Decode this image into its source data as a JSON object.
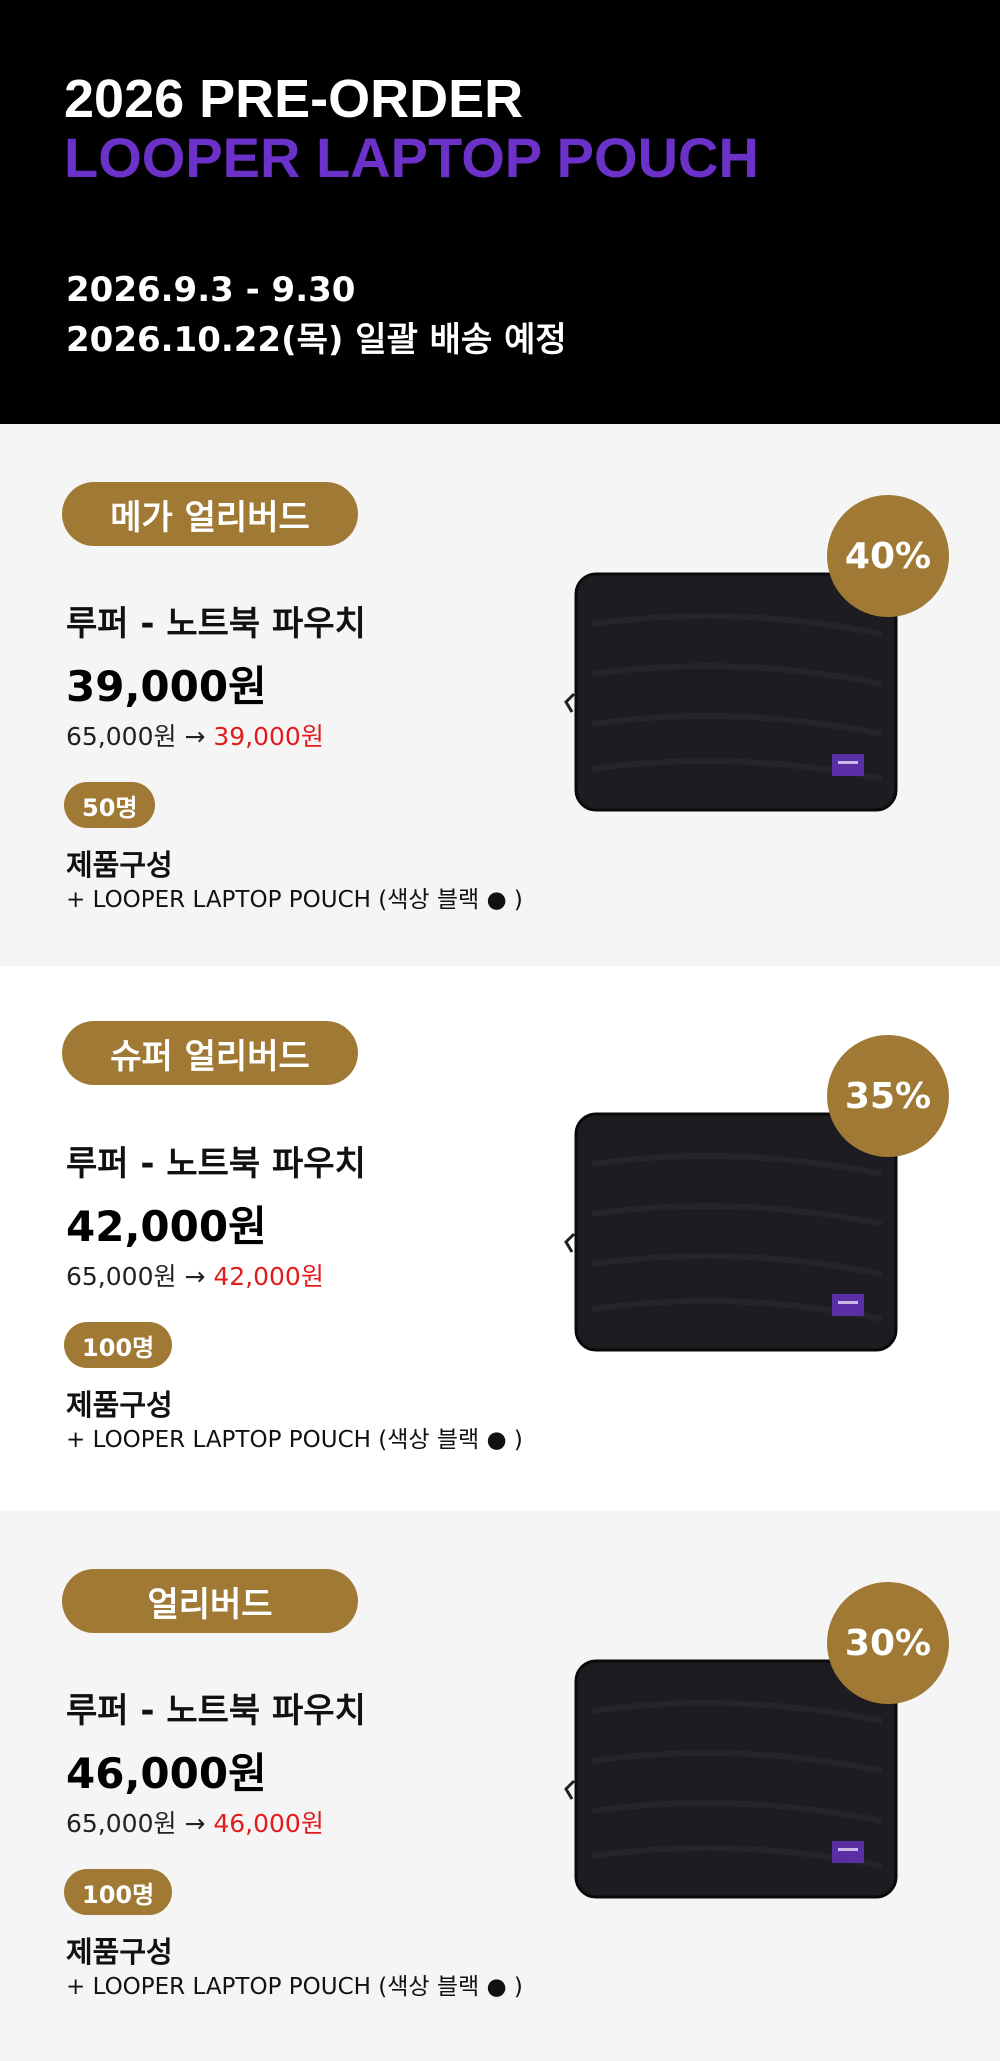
{
  "hero": {
    "title_line1": "2026 PRE-ORDER",
    "title_line2": "LOOPER LAPTOP POUCH",
    "period": "2026.9.3 - 9.30",
    "delivery": "2026.10.22(목) 일괄 배송 예정"
  },
  "tiers": [
    {
      "badge": "메가 얼리버드",
      "discount": "40%",
      "product_name": "루퍼 - 노트북 파우치",
      "price": "39,000원",
      "original_price": "65,000원",
      "arrow": "→",
      "sale_price": "39,000원",
      "quantity": "50명",
      "composition_title": "제품구성",
      "composition_item": "+ LOOPER LAPTOP POUCH  (색상 블랙 ● )"
    },
    {
      "badge": "슈퍼 얼리버드",
      "discount": "35%",
      "product_name": "루퍼 - 노트북 파우치",
      "price": "42,000원",
      "original_price": "65,000원",
      "arrow": "→",
      "sale_price": "42,000원",
      "quantity": "100명",
      "composition_title": "제품구성",
      "composition_item": "+ LOOPER LAPTOP POUCH  (색상 블랙 ● )"
    },
    {
      "badge": "얼리버드",
      "discount": "30%",
      "product_name": "루퍼 - 노트북 파우치",
      "price": "46,000원",
      "original_price": "65,000원",
      "arrow": "→",
      "sale_price": "46,000원",
      "quantity": "100명",
      "composition_title": "제품구성",
      "composition_item": "+ LOOPER LAPTOP POUCH  (색상 블랙 ● )"
    }
  ],
  "colors": {
    "hero_background": "#000000",
    "title_accent": "#6c31c9",
    "badge_gold": "#a07a34",
    "sale_red": "#e21c1c",
    "section_grey": "#f5f5f5"
  },
  "icons": {
    "product_image": "black-laptop-pouch-image"
  }
}
